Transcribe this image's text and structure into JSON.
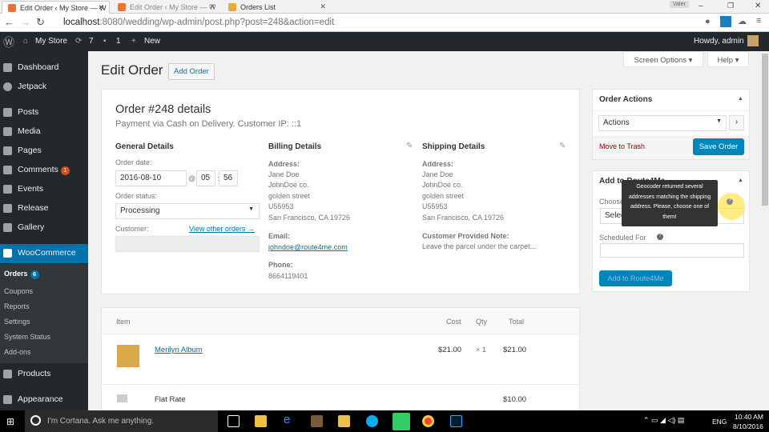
{
  "browser": {
    "tabs": [
      {
        "label": "Edit Order ‹ My Store — W"
      },
      {
        "label": "Edit Order ‹ My Store — W"
      },
      {
        "label": "Orders List"
      }
    ],
    "url_host": "localhost",
    "url_rest": ":8080/wedding/wp-admin/post.php?post=248&action=edit",
    "profile": "Valer"
  },
  "adminbar": {
    "site": "My Store",
    "updates": "7",
    "comments": "1",
    "new": "New",
    "howdy": "Howdy, admin"
  },
  "sidebar": {
    "items": [
      {
        "label": "Dashboard"
      },
      {
        "label": "Jetpack"
      },
      {
        "label": "Posts"
      },
      {
        "label": "Media"
      },
      {
        "label": "Pages"
      },
      {
        "label": "Comments",
        "badge": "1"
      },
      {
        "label": "Events"
      },
      {
        "label": "Release"
      },
      {
        "label": "Gallery"
      },
      {
        "label": "WooCommerce"
      },
      {
        "label": "Products"
      },
      {
        "label": "Appearance"
      }
    ],
    "sub": [
      {
        "label": "Orders",
        "badge": "6"
      },
      {
        "label": "Coupons"
      },
      {
        "label": "Reports"
      },
      {
        "label": "Settings"
      },
      {
        "label": "System Status"
      },
      {
        "label": "Add-ons"
      }
    ]
  },
  "page": {
    "title": "Edit Order",
    "add_order": "Add Order",
    "screen_options": "Screen Options ▾",
    "help": "Help ▾"
  },
  "order": {
    "title": "Order #248 details",
    "subtitle": "Payment via Cash on Delivery. Customer IP: ::1",
    "general": {
      "heading": "General Details",
      "date_label": "Order date:",
      "date": "2016-08-10",
      "at": "@",
      "hour": "05",
      "colon": ":",
      "minute": "56",
      "status_label": "Order status:",
      "status": "Processing",
      "customer_label": "Customer:",
      "view_other": "View other orders →"
    },
    "billing": {
      "heading": "Billing Details",
      "address_label": "Address:",
      "address": [
        "Jane Doe",
        "JohnDoe co.",
        "golden street",
        "U55953",
        "San Francisco, CA 19726"
      ],
      "email_label": "Email:",
      "email": "johndoe@route4me.com",
      "phone_label": "Phone:",
      "phone": "8664119401"
    },
    "shipping": {
      "heading": "Shipping Details",
      "address_label": "Address:",
      "address": [
        "Jane Doe",
        "JohnDoe co.",
        "golden street",
        "U55953",
        "San Francisco, CA 19726"
      ],
      "note_label": "Customer Provided Note:",
      "note": "Leave the parcel under the carpet..."
    }
  },
  "items": {
    "headers": {
      "item": "Item",
      "cost": "Cost",
      "qty": "Qty",
      "total": "Total"
    },
    "rows": [
      {
        "name": "Merilyn Album",
        "cost": "$21.00",
        "qty": "× 1",
        "total": "$21.00"
      }
    ],
    "shipping": {
      "name": "Flat Rate",
      "total": "$10.00"
    }
  },
  "actions": {
    "heading": "Order Actions",
    "select": "Actions",
    "trash": "Move to Trash",
    "save": "Save Order"
  },
  "route": {
    "heading": "Add to Route4Me",
    "choose": "Choose",
    "select": "Select",
    "scheduled": "Scheduled For",
    "button": "Add to Route4Me",
    "tooltip": "Geocoder returned several addresses matching the shipping address. Please, choose one of them!"
  },
  "taskbar": {
    "cortana": "I'm Cortana. Ask me anything.",
    "lang": "ENG",
    "time": "10:40 AM",
    "date": "8/10/2016"
  }
}
